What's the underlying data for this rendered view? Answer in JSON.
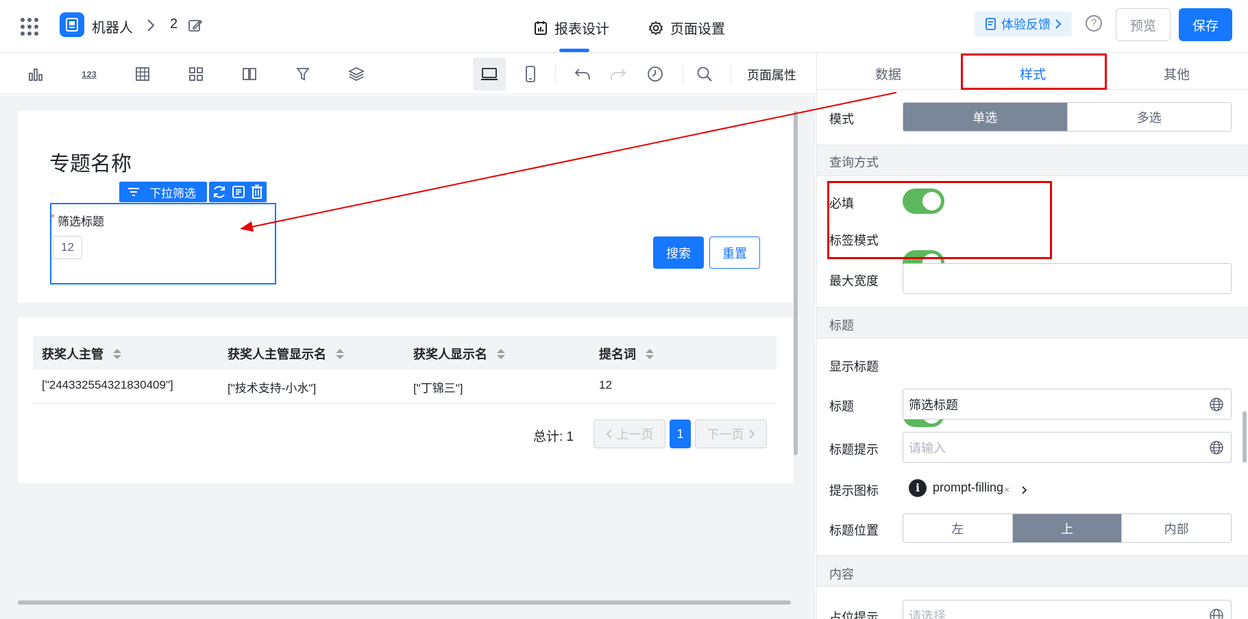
{
  "header": {
    "breadcrumb_app": "机器人",
    "breadcrumb_page": "2",
    "tab_report_design": "报表设计",
    "tab_page_settings": "页面设置",
    "feedback_label": "体验反馈",
    "preview_label": "预览",
    "save_label": "保存",
    "help_glyph": "?"
  },
  "toolbar": {
    "page_properties_label": "页面属性",
    "icons": [
      "bar-chart-icon",
      "number-icon",
      "table-icon",
      "grid-icon",
      "columns-icon",
      "filter-icon",
      "layers-icon",
      "desktop-icon",
      "mobile-icon",
      "undo-icon",
      "redo-icon",
      "history-icon",
      "search-icon"
    ],
    "number_icon_text": "123"
  },
  "canvas": {
    "page_title": "专题名称",
    "filter_widget_label": "下拉筛选",
    "filter_title": "筛选标题",
    "filter_required_mark": "*",
    "filter_value": "12",
    "search_button": "搜索",
    "reset_button": "重置",
    "table": {
      "columns": [
        "获奖人主管",
        "获奖人主管显示名",
        "获奖人显示名",
        "提名词"
      ],
      "rows": [
        [
          "[\"244332554321830409\"]",
          "[\"技术支持-小水\"]",
          "[\"丁锦三\"]",
          "12"
        ]
      ]
    },
    "pagination": {
      "total_label": "总计: 1",
      "prev_label": "上一页",
      "current_page": "1",
      "next_label": "下一页"
    }
  },
  "panel": {
    "tabs": [
      "数据",
      "样式",
      "其他"
    ],
    "active_tab": "样式",
    "mode_label": "模式",
    "mode_options": [
      "单选",
      "多选"
    ],
    "mode_selected": "单选",
    "section_query": "查询方式",
    "required_label": "必填",
    "required_on": true,
    "tag_mode_label": "标签模式",
    "tag_mode_on": true,
    "max_width_label": "最大宽度",
    "max_width_value": "",
    "section_title": "标题",
    "show_title_label": "显示标题",
    "show_title_on": true,
    "title_label": "标题",
    "title_value": "筛选标题",
    "title_hint_label": "标题提示",
    "title_hint_placeholder": "请输入",
    "hint_icon_label": "提示图标",
    "hint_icon_value": "prompt-filling",
    "hint_icon_clear": "×",
    "title_position_label": "标题位置",
    "title_position_options": [
      "左",
      "上",
      "内部"
    ],
    "title_position_selected": "上",
    "section_content": "内容",
    "placeholder_label": "占位提示",
    "placeholder_value": "请选择"
  },
  "colors": {
    "primary": "#1677ff",
    "toggle_on": "#5cb85c",
    "segment_selected": "#7a8799",
    "annotation_red": "#e50000"
  }
}
